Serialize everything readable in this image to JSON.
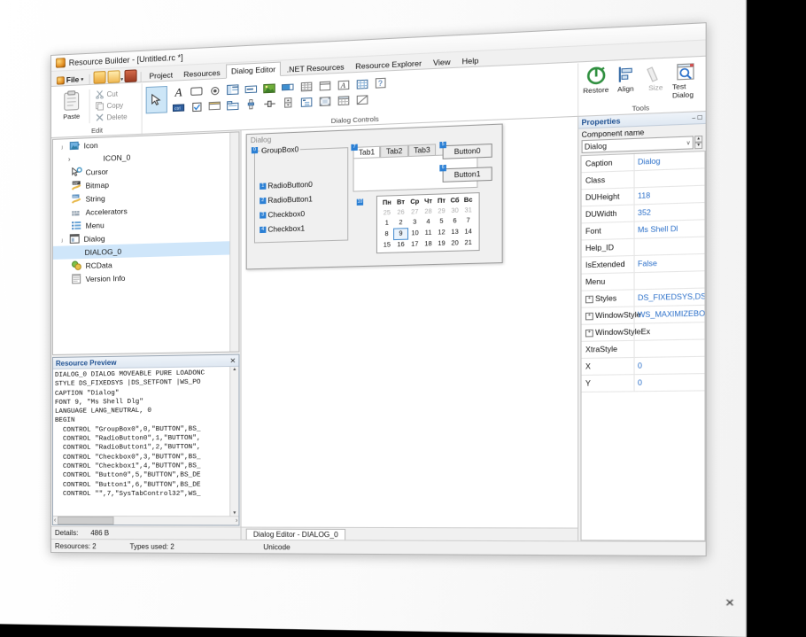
{
  "outer_window": {
    "minimize": "–",
    "maximize": "☐",
    "close": "✕",
    "bottom_close": "✕"
  },
  "app": {
    "title": "Resource Builder - [Untitled.rc *]",
    "icon": "app-icon"
  },
  "menubar": {
    "file_label": "File",
    "file_caret": "▾",
    "quick_icons": [
      "folder-open-icon",
      "open-icon",
      "dropdown-icon",
      "save-icon"
    ],
    "tabs": [
      {
        "label": "Project",
        "active": false
      },
      {
        "label": "Resources",
        "active": false
      },
      {
        "label": "Dialog Editor",
        "active": true
      },
      {
        "label": ".NET Resources",
        "active": false
      },
      {
        "label": "Resource Explorer",
        "active": false
      },
      {
        "label": "View",
        "active": false
      },
      {
        "label": "Help",
        "active": false
      }
    ]
  },
  "ribbon": {
    "groups": [
      {
        "name": "Edit",
        "label": "Edit",
        "paste_label": "Paste",
        "items": [
          {
            "label": "Cut",
            "icon": "cut-icon"
          },
          {
            "label": "Copy",
            "icon": "copy-icon"
          },
          {
            "label": "Delete",
            "icon": "delete-icon"
          }
        ]
      },
      {
        "name": "Dialog Controls",
        "label": "Dialog Controls",
        "row1": [
          "pointer-icon",
          "label-icon",
          "button-icon",
          "radio-icon",
          "listview-icon",
          "edit-icon",
          "picture-icon",
          "progress-icon",
          "listbox-icon",
          "groupbox-icon",
          "richedit-icon",
          "grid-icon",
          "help-icon"
        ],
        "row2": [
          "static-icon",
          "checkbox-icon",
          "combobox-icon",
          "tab-icon",
          "slider-icon",
          "trackbar-icon",
          "spin-icon",
          "treeview-icon",
          "animate-icon",
          "calendar-icon",
          "custom-icon"
        ]
      },
      {
        "name": "Tools",
        "label": "Tools",
        "buttons": [
          {
            "label": "Restore",
            "icon": "restore-icon"
          },
          {
            "label": "Align",
            "icon": "align-icon"
          },
          {
            "label": "Size",
            "icon": "size-icon"
          },
          {
            "label": "Test Dialog",
            "icon": "test-dialog-icon"
          }
        ]
      }
    ]
  },
  "tree": {
    "items": [
      {
        "label": "Icon",
        "icon": "icon-resource-icon",
        "twisty": "ⱼ",
        "indent": 0,
        "selected": false
      },
      {
        "label": "ICON_0",
        "icon": "",
        "twisty": "›",
        "indent": 1,
        "selected": false
      },
      {
        "label": "Cursor",
        "icon": "cursor-resource-icon",
        "twisty": "",
        "indent": 0,
        "selected": false
      },
      {
        "label": "Bitmap",
        "icon": "bitmap-resource-icon",
        "twisty": "",
        "indent": 0,
        "selected": false
      },
      {
        "label": "String",
        "icon": "string-resource-icon",
        "twisty": "",
        "indent": 0,
        "selected": false
      },
      {
        "label": "Accelerators",
        "icon": "accelerators-resource-icon",
        "twisty": "",
        "indent": 0,
        "selected": false
      },
      {
        "label": "Menu",
        "icon": "menu-resource-icon",
        "twisty": "",
        "indent": 0,
        "selected": false
      },
      {
        "label": "Dialog",
        "icon": "dialog-resource-icon",
        "twisty": "ⱼ",
        "indent": 0,
        "selected": false
      },
      {
        "label": "DIALOG_0",
        "icon": "",
        "twisty": "",
        "indent": 2,
        "selected": true
      },
      {
        "label": "RCData",
        "icon": "rcdata-resource-icon",
        "twisty": "",
        "indent": 0,
        "selected": false
      },
      {
        "label": "Version Info",
        "icon": "versioninfo-resource-icon",
        "twisty": "",
        "indent": 0,
        "selected": false
      }
    ]
  },
  "resource_preview": {
    "title": "Resource Preview",
    "close": "✕",
    "code": "DIALOG_0 DIALOG MOVEABLE PURE LOADONC\nSTYLE DS_FIXEDSYS |DS_SETFONT |WS_PO\nCAPTION \"Dialog\"\nFONT 9, \"Ms Shell Dlg\"\nLANGUAGE LANG_NEUTRAL, 0\nBEGIN\n  CONTROL \"GroupBox0\",0,\"BUTTON\",BS_\n  CONTROL \"RadioButton0\",1,\"BUTTON\",\n  CONTROL \"RadioButton1\",2,\"BUTTON\",\n  CONTROL \"Checkbox0\",3,\"BUTTON\",BS_\n  CONTROL \"Checkbox1\",4,\"BUTTON\",BS_\n  CONTROL \"Button0\",5,\"BUTTON\",BS_DE\n  CONTROL \"Button1\",6,\"BUTTON\",BS_DE\n  CONTROL \"\",7,\"SysTabControl32\",WS_",
    "scroll_up": "▲",
    "scroll_down": "▼",
    "scroll_left": "‹",
    "scroll_right": "›"
  },
  "details_bar": {
    "label": "Details:",
    "value": "486 B"
  },
  "dialog_editor": {
    "caption": "Dialog",
    "groupbox": {
      "label": "GroupBox0",
      "badge": "0"
    },
    "controls": [
      {
        "label": "RadioButton0",
        "badge": "1",
        "type": "radio"
      },
      {
        "label": "RadioButton1",
        "badge": "2",
        "type": "radio"
      },
      {
        "label": "Checkbox0",
        "badge": "3",
        "type": "checkbox"
      },
      {
        "label": "Checkbox1",
        "badge": "4",
        "type": "checkbox"
      }
    ],
    "tabcontrol": {
      "badge": "7",
      "tabs": [
        {
          "label": "Tab1",
          "active": true
        },
        {
          "label": "Tab2",
          "active": false
        },
        {
          "label": "Tab3",
          "active": false
        }
      ]
    },
    "buttons": [
      {
        "label": "Button0",
        "badge": "5"
      },
      {
        "label": "Button1",
        "badge": "6"
      }
    ],
    "calendar": {
      "badge": "10",
      "dow": [
        "Пн",
        "Вт",
        "Ср",
        "Чт",
        "Пт",
        "Сб",
        "Вс"
      ],
      "weeks": [
        [
          {
            "d": "25",
            "dim": true
          },
          {
            "d": "26",
            "dim": true
          },
          {
            "d": "27",
            "dim": true
          },
          {
            "d": "28",
            "dim": true
          },
          {
            "d": "29",
            "dim": true
          },
          {
            "d": "30",
            "dim": true
          },
          {
            "d": "31",
            "dim": true
          }
        ],
        [
          {
            "d": "1"
          },
          {
            "d": "2"
          },
          {
            "d": "3"
          },
          {
            "d": "4"
          },
          {
            "d": "5"
          },
          {
            "d": "6"
          },
          {
            "d": "7"
          }
        ],
        [
          {
            "d": "8"
          },
          {
            "d": "9",
            "selected": true
          },
          {
            "d": "10"
          },
          {
            "d": "11"
          },
          {
            "d": "12"
          },
          {
            "d": "13"
          },
          {
            "d": "14"
          }
        ],
        [
          {
            "d": "15"
          },
          {
            "d": "16"
          },
          {
            "d": "17"
          },
          {
            "d": "18"
          },
          {
            "d": "19"
          },
          {
            "d": "20"
          },
          {
            "d": "21"
          }
        ]
      ]
    },
    "editor_tab": "Dialog Editor - DIALOG_0"
  },
  "properties": {
    "title": "Properties",
    "minimize": "–",
    "maximize": "☐",
    "component_name_label": "Component name",
    "component_name_value": "Dialog",
    "combo_caret": "∨",
    "spin_up": "▴",
    "spin_down": "▾",
    "rows": [
      {
        "key": "Caption",
        "value": "Dialog",
        "expand": false
      },
      {
        "key": "Class",
        "value": "",
        "expand": false
      },
      {
        "key": "DUHeight",
        "value": "118",
        "expand": false
      },
      {
        "key": "DUWidth",
        "value": "352",
        "expand": false
      },
      {
        "key": "Font",
        "value": "Ms Shell Dl",
        "expand": false
      },
      {
        "key": "Help_ID",
        "value": "",
        "expand": false
      },
      {
        "key": "IsExtended",
        "value": "False",
        "expand": false
      },
      {
        "key": "Menu",
        "value": "",
        "expand": false
      },
      {
        "key": "Styles",
        "value": "DS_FIXEDSYS,DS_SETFONT",
        "expand": true
      },
      {
        "key": "WindowStyle",
        "value": "WS_MAXIMIZEBOX,WS_MINIMIZ",
        "expand": true
      },
      {
        "key": "WindowStyleEx",
        "value": "",
        "expand": true
      },
      {
        "key": "XtraStyle",
        "value": "",
        "expand": false
      },
      {
        "key": "X",
        "value": "0",
        "expand": false
      },
      {
        "key": "Y",
        "value": "0",
        "expand": false
      }
    ]
  },
  "statusbar": {
    "resources": "Resources: 2",
    "types_used": "Types used: 2",
    "encoding": "Unicode"
  },
  "colors": {
    "accent": "#2a7fd4",
    "selection": "#cfe6fa",
    "property_value": "#2a6fc9",
    "panel_header": "#1d4f91"
  }
}
